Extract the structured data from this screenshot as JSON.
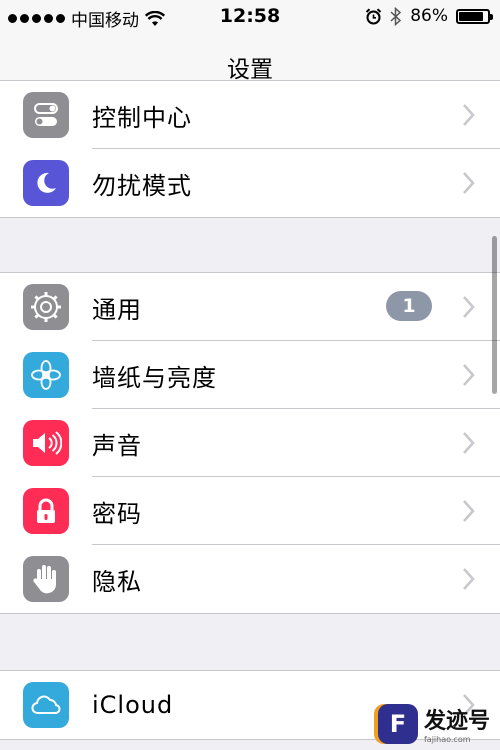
{
  "status_bar": {
    "carrier": "中国移动",
    "time": "12:58",
    "battery_percent": "86%",
    "battery_level": 0.86,
    "icons": [
      "signal-dots-icon",
      "wifi-icon",
      "alarm-icon",
      "bluetooth-icon",
      "battery-icon"
    ]
  },
  "nav": {
    "title": "设置"
  },
  "group1": {
    "items": [
      {
        "label": "控制中心",
        "icon": "control-center-icon",
        "color": "#8e8e93"
      },
      {
        "label": "勿扰模式",
        "icon": "moon-icon",
        "color": "#5856d6"
      }
    ]
  },
  "group2": {
    "items": [
      {
        "label": "通用",
        "icon": "gear-icon",
        "color": "#8e8e93",
        "badge": "1"
      },
      {
        "label": "墙纸与亮度",
        "icon": "flower-icon",
        "color": "#34aadc"
      },
      {
        "label": "声音",
        "icon": "speaker-icon",
        "color": "#ff2d55"
      },
      {
        "label": "密码",
        "icon": "lock-icon",
        "color": "#ff2d55"
      },
      {
        "label": "隐私",
        "icon": "hand-icon",
        "color": "#8e8e93"
      }
    ]
  },
  "group3": {
    "items": [
      {
        "label": "iCloud",
        "icon": "cloud-icon",
        "color": "#34aadc"
      }
    ]
  },
  "watermark": {
    "name": "发迹号",
    "url": "fajihao.com",
    "logo_letter": "F"
  }
}
